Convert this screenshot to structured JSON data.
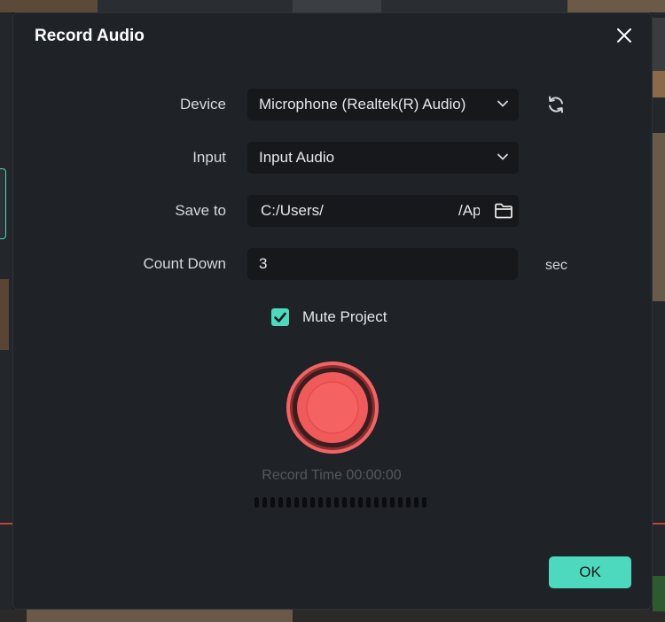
{
  "dialog": {
    "title": "Record Audio",
    "close_icon": "close-icon"
  },
  "form": {
    "device": {
      "label": "Device",
      "value": "Microphone (Realtek(R) Audio)",
      "dropdown_icon": "chevron-down-icon",
      "refresh_icon": "refresh-icon"
    },
    "input": {
      "label": "Input",
      "value": "Input Audio",
      "dropdown_icon": "chevron-down-icon"
    },
    "save_to": {
      "label": "Save to",
      "value": "C:/Users/",
      "value_tail": "/Ap",
      "folder_icon": "folder-icon"
    },
    "count_down": {
      "label": "Count Down",
      "value": "3",
      "unit": "sec"
    },
    "mute_project": {
      "label": "Mute Project",
      "checked": true
    }
  },
  "recorder": {
    "record_icon": "record-button-icon",
    "record_time_label": "Record Time 00:00:00",
    "level_meter_segments": 22,
    "level": 0
  },
  "footer": {
    "ok_label": "OK"
  },
  "colors": {
    "accent": "#4dd9be",
    "record": "#f05a5a",
    "dialog_bg": "#1f2227",
    "field_bg": "#16181b"
  }
}
